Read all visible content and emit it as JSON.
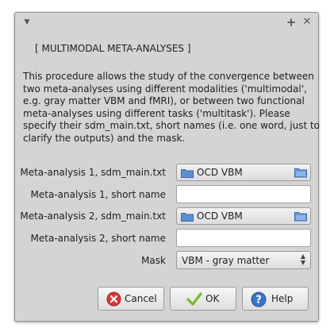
{
  "window": {
    "titlebar_icons": {
      "menu": "chevron-down-icon",
      "maximize": "plus-icon",
      "close": "close-icon"
    }
  },
  "heading": "[ MULTIMODAL META-ANALYSES ]",
  "description_lines": [
    "This procedure allows the study of the convergence between",
    "two meta-analyses using different modalities ('multimodal',",
    "e.g. gray matter VBM and fMRI), or between two functional",
    "meta-analyses using different tasks ('multitask'). Please",
    "specify their sdm_main.txt, short names (i.e. one word, just to",
    "clarify the outputs) and the mask."
  ],
  "form": {
    "ma1_file_label": "Meta-analysis 1, sdm_main.txt",
    "ma1_file_value": "OCD VBM",
    "ma1_name_label": "Meta-analysis 1, short name",
    "ma1_name_value": "",
    "ma2_file_label": "Meta-analysis 2, sdm_main.txt",
    "ma2_file_value": "OCD VBM",
    "ma2_name_label": "Meta-analysis 2, short name",
    "ma2_name_value": "",
    "mask_label": "Mask",
    "mask_value": "VBM - gray matter"
  },
  "buttons": {
    "cancel": "Cancel",
    "ok": "OK",
    "help": "Help"
  },
  "colors": {
    "dialog_bg": "#d4d4d4",
    "folder_icon": "#5b8fd0",
    "cancel_icon": "#d53a3a",
    "ok_icon": "#7ab826",
    "help_icon": "#3b74c9"
  }
}
